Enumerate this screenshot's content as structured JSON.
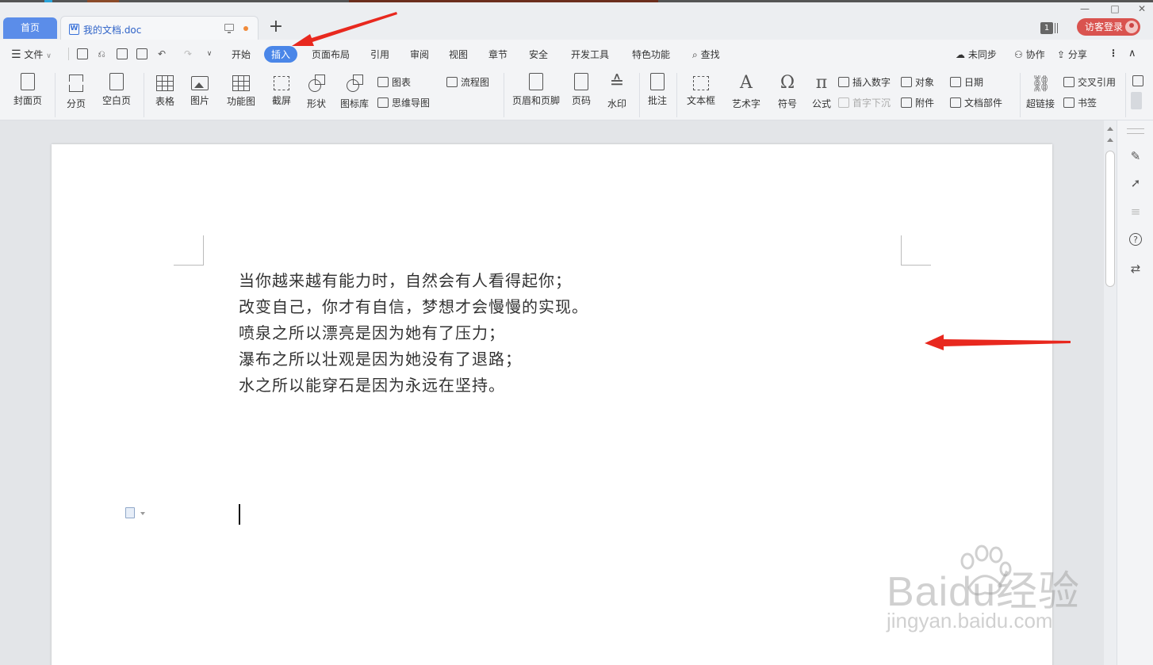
{
  "tabs": {
    "home_label": "首页",
    "doc_title": "我的文档.doc"
  },
  "titlebar": {
    "badge": "1",
    "login_label": "访客登录"
  },
  "menu": {
    "file_label": "文件",
    "items": [
      "开始",
      "插入",
      "页面布局",
      "引用",
      "审阅",
      "视图",
      "章节",
      "安全",
      "开发工具",
      "特色功能"
    ],
    "active_item": "插入",
    "search_label": "查找",
    "sync_label": "未同步",
    "collab_label": "协作",
    "share_label": "分享"
  },
  "ribbon": {
    "cover_page": "封面页",
    "page_break": "分页",
    "blank_page": "空白页",
    "table": "表格",
    "picture": "图片",
    "function_chart": "功能图",
    "screenshot": "截屏",
    "shape": "形状",
    "icon_library": "图标库",
    "chart": "图表",
    "mind_map": "思维导图",
    "flowchart": "流程图",
    "header_footer": "页眉和页脚",
    "page_number": "页码",
    "watermark": "水印",
    "comment": "批注",
    "text_box": "文本框",
    "word_art": "艺术字",
    "symbol": "符号",
    "formula": "公式",
    "insert_number": "插入数字",
    "drop_cap": "首字下沉",
    "object": "对象",
    "attachment": "附件",
    "date": "日期",
    "doc_parts": "文档部件",
    "hyperlink": "超链接",
    "cross_reference": "交叉引用",
    "bookmark": "书签"
  },
  "document": {
    "lines": [
      "当你越来越有能力时，自然会有人看得起你；",
      "改变自己，你才有自信，梦想才会慢慢的实现。",
      "喷泉之所以漂亮是因为她有了压力；",
      "瀑布之所以壮观是因为她没有了退路；",
      "水之所以能穿石是因为永远在坚持。"
    ]
  },
  "watermark": {
    "brand": "Baidu经验",
    "url": "jingyan.baidu.com"
  },
  "colors": {
    "accent": "#4a86e8",
    "login": "#d9534f",
    "annotation_arrow": "#e8281e"
  }
}
